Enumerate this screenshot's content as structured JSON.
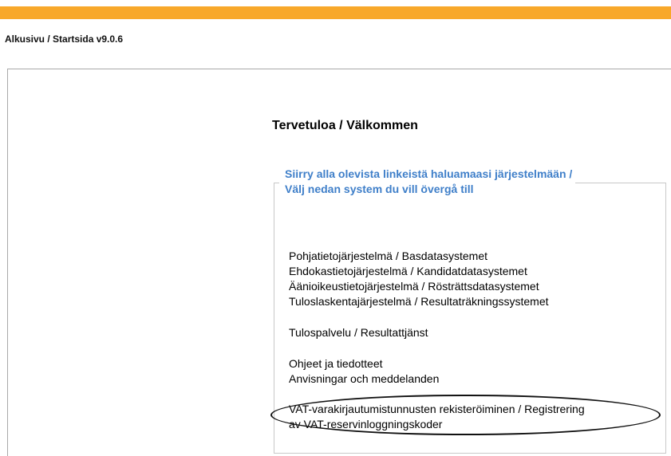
{
  "breadcrumb": "Alkusivu / Startsida v9.0.6",
  "welcome_title": "Tervetuloa / Välkommen",
  "legend": {
    "line1": "Siirry alla olevista linkeistä haluamaasi järjestelmään /",
    "line2": "Välj nedan system du vill övergå till"
  },
  "links": {
    "group1": [
      "Pohjatietojärjestelmä / Basdatasystemet",
      "Ehdokastietojärjestelmä / Kandidatdatasystemet",
      "Äänioikeustietojärjestelmä / Rösträttsdatasystemet",
      "Tuloslaskentajärjestelmä / Resultaträkningssystemet"
    ],
    "group2": [
      "Tulospalvelu / Resultattjänst"
    ],
    "group3": [
      "Ohjeet ja tiedotteet",
      "Anvisningar och meddelanden"
    ],
    "vat": {
      "line1": "VAT-varakirjautumistunnusten rekisteröiminen / Registrering",
      "line2": "av VAT-reservinloggningskoder"
    }
  },
  "colors": {
    "topbar": "#f8a82a",
    "legend_text": "#3f7fc9",
    "highlight_oval": "#111111"
  }
}
